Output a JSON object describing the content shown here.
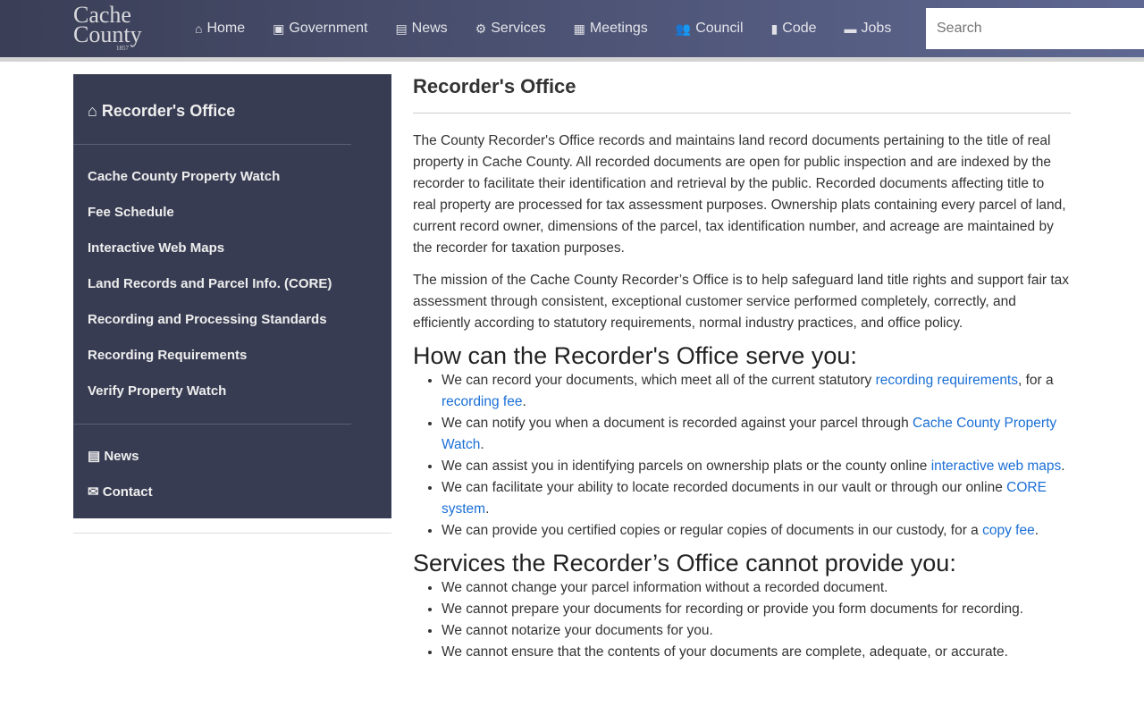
{
  "header": {
    "logo": "Cache County",
    "logo_year": "1857",
    "search_placeholder": "Search",
    "nav": [
      {
        "icon": "home-icon",
        "glyph": "⌂",
        "label": "Home"
      },
      {
        "icon": "address-book-icon",
        "glyph": "▣",
        "label": "Government"
      },
      {
        "icon": "newspaper-icon",
        "glyph": "▤",
        "label": "News"
      },
      {
        "icon": "gear-icon",
        "glyph": "⚙",
        "label": "Services"
      },
      {
        "icon": "calendar-icon",
        "glyph": "▦",
        "label": "Meetings"
      },
      {
        "icon": "users-icon",
        "glyph": "👥",
        "label": "Council"
      },
      {
        "icon": "book-icon",
        "glyph": "▮",
        "label": "Code"
      },
      {
        "icon": "briefcase-icon",
        "glyph": "▬",
        "label": "Jobs"
      }
    ]
  },
  "sidebar": {
    "title": "Recorder's Office",
    "items": [
      "Cache County Property Watch",
      "Fee Schedule",
      "Interactive Web Maps",
      "Land Records and Parcel Info. (CORE)",
      "Recording and Processing Standards",
      "Recording Requirements",
      "Verify Property Watch"
    ],
    "news": "News",
    "contact": "Contact"
  },
  "main": {
    "title": "Recorder's Office",
    "p1": "The County Recorder's Office records and maintains land record documents pertaining to the title of real property in Cache County. All recorded documents are open for public inspection and are indexed by the recorder to facilitate their identification and retrieval by the public. Recorded documents affecting title to real property are processed for tax assessment purposes. Ownership plats containing every parcel of land, current record owner, dimensions of the parcel, tax identification number, and acreage are maintained by the recorder for taxation purposes.",
    "p2": "The mission of the Cache County Recorder’s Office is to help safeguard land title rights and support fair tax assessment through consistent, exceptional customer service performed completely, correctly, and efficiently according to statutory requirements, normal industry practices, and office policy.",
    "h_serve": "How can the Recorder's Office serve you:",
    "serve": [
      {
        "a": "We can record your documents, which meet all of the current statutory ",
        "l1": "recording requirements",
        "b": ", for a ",
        "l2": "recording fee",
        "c": "."
      },
      {
        "a": "We can notify you when a document is recorded against your parcel through ",
        "l1": "Cache County Property Watch",
        "b": ".",
        "l2": "",
        "c": ""
      },
      {
        "a": "We can assist you in identifying parcels on ownership plats or the county online ",
        "l1": "interactive web maps",
        "b": ".",
        "l2": "",
        "c": ""
      },
      {
        "a": "We can facilitate your ability to locate recorded documents in our vault or through our online ",
        "l1": "CORE system",
        "b": ".",
        "l2": "",
        "c": ""
      },
      {
        "a": "We can provide you certified copies or regular copies of documents in our custody, for a ",
        "l1": "copy fee",
        "b": ".",
        "l2": "",
        "c": ""
      }
    ],
    "h_cannot": "Services the Recorder’s Office cannot provide you:",
    "cannot": [
      "We cannot change your parcel information without a recorded document.",
      "We cannot prepare your documents for recording or provide you form documents for recording.",
      "We cannot notarize your documents for you.",
      "We cannot ensure that the contents of your documents are complete, adequate, or accurate."
    ]
  }
}
